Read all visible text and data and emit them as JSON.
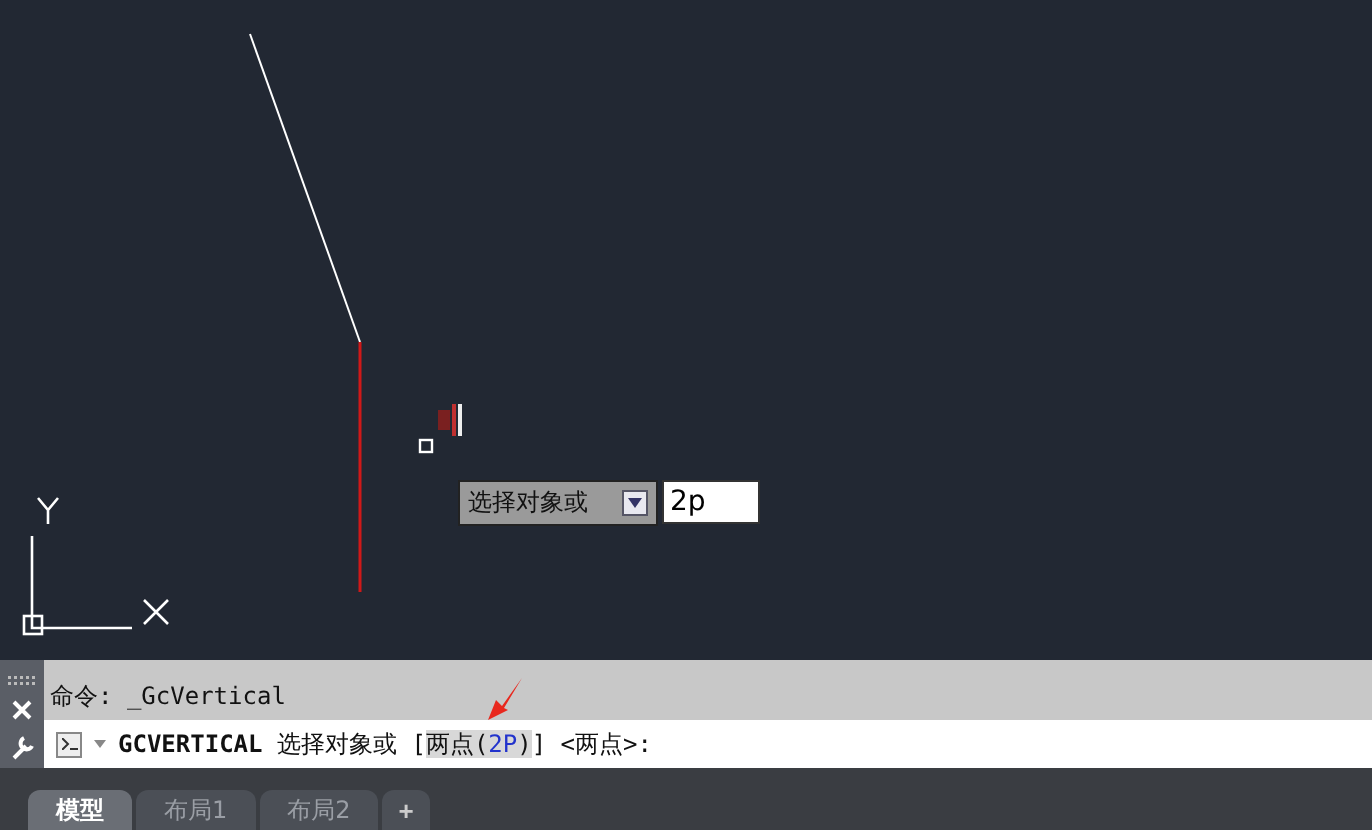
{
  "canvas": {
    "tooltip": {
      "label": "选择对象或"
    },
    "input": {
      "value": "2p"
    }
  },
  "command_history": {
    "text": "命令: _GcVertical"
  },
  "command_line": {
    "command": "GCVERTICAL",
    "prompt": "选择对象或 [",
    "option_label": "两点(",
    "option_key": "2P",
    "option_end": ")",
    "suffix": "] <两点>:"
  },
  "tabs": [
    {
      "label": "模型",
      "selected": true
    },
    {
      "label": "布局1",
      "selected": false
    },
    {
      "label": "布局2",
      "selected": false
    }
  ],
  "add_tab": "+"
}
